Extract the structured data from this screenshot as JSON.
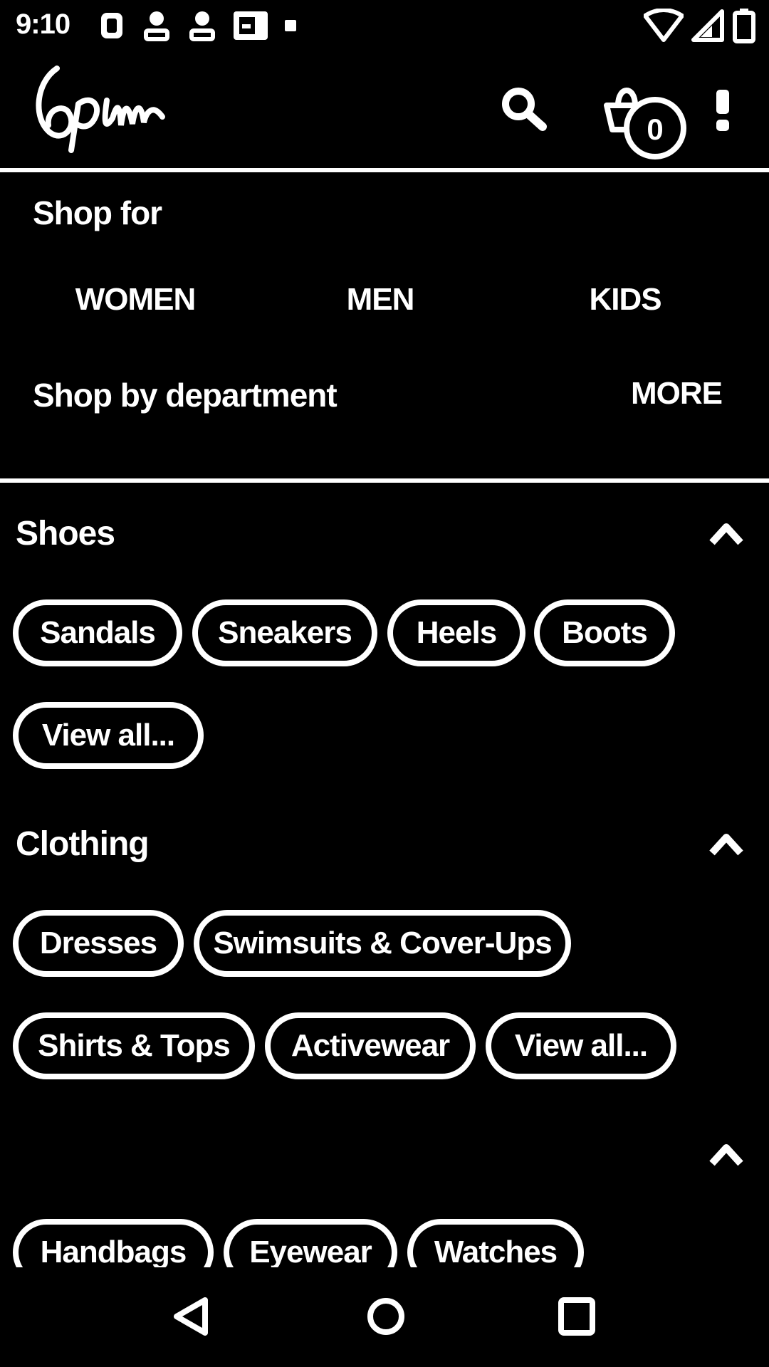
{
  "status_bar": {
    "time": "9:10",
    "left_icons": [
      "sync-icon",
      "person-icon",
      "person-icon",
      "sim-card-icon",
      "dot-icon"
    ],
    "right_icons": [
      "wifi-icon",
      "signal-icon",
      "battery-icon"
    ]
  },
  "app_bar": {
    "logo_text": "6pm",
    "bag_count": "0",
    "icons": [
      "search-icon",
      "shopping-bag-icon",
      "overflow-menu-icon"
    ]
  },
  "shop_for": {
    "title": "Shop for",
    "tabs": [
      "WOMEN",
      "MEN",
      "KIDS"
    ]
  },
  "shop_by_department": {
    "title": "Shop by department",
    "more_label": "MORE"
  },
  "categories": [
    {
      "title": "Shoes",
      "chips": [
        "Sandals",
        "Sneakers",
        "Heels",
        "Boots",
        "View all..."
      ]
    },
    {
      "title": "Clothing",
      "chips": [
        "Dresses",
        "Swimsuits & Cover-Ups",
        "Shirts & Tops",
        "Activewear",
        "View all..."
      ]
    },
    {
      "title": "",
      "chips": [
        "Handbags",
        "Eyewear",
        "Watches"
      ]
    }
  ],
  "nav_bar": {
    "icons": [
      "back-icon",
      "home-icon",
      "recent-apps-icon"
    ]
  },
  "colors": {
    "background": "#000000",
    "foreground": "#ffffff"
  }
}
